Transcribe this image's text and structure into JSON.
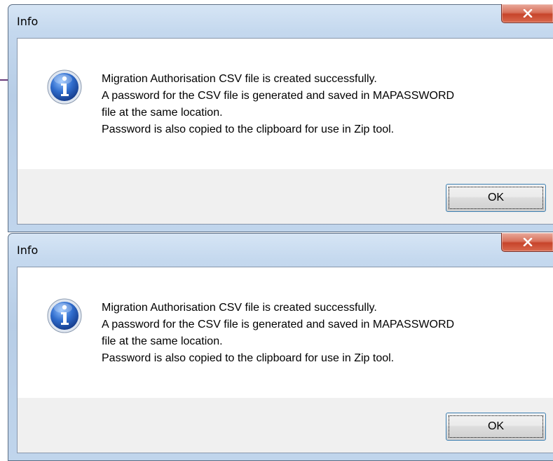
{
  "dialogs": [
    {
      "title": "Info",
      "close_icon": "close-icon",
      "icon": "information-icon",
      "message_lines": [
        "Migration Authorisation CSV file is created successfully.",
        "A password for the CSV file is generated and saved in MAPASSWORD",
        "file at the same location.",
        "Password is also copied to the clipboard for use in Zip tool."
      ],
      "ok_label": "OK"
    },
    {
      "title": "Info",
      "close_icon": "close-icon",
      "icon": "information-icon",
      "message_lines": [
        "Migration Authorisation CSV file is created successfully.",
        "A password for the CSV file is generated and saved in MAPASSWORD",
        "file at the same location.",
        "Password is also copied to the clipboard for use in Zip tool."
      ],
      "ok_label": "OK"
    }
  ],
  "colors": {
    "close_button": "#c7442a",
    "titlebar": "#c4d8ee",
    "footer": "#f0f0f0",
    "info_icon": "#2b5fb6"
  }
}
